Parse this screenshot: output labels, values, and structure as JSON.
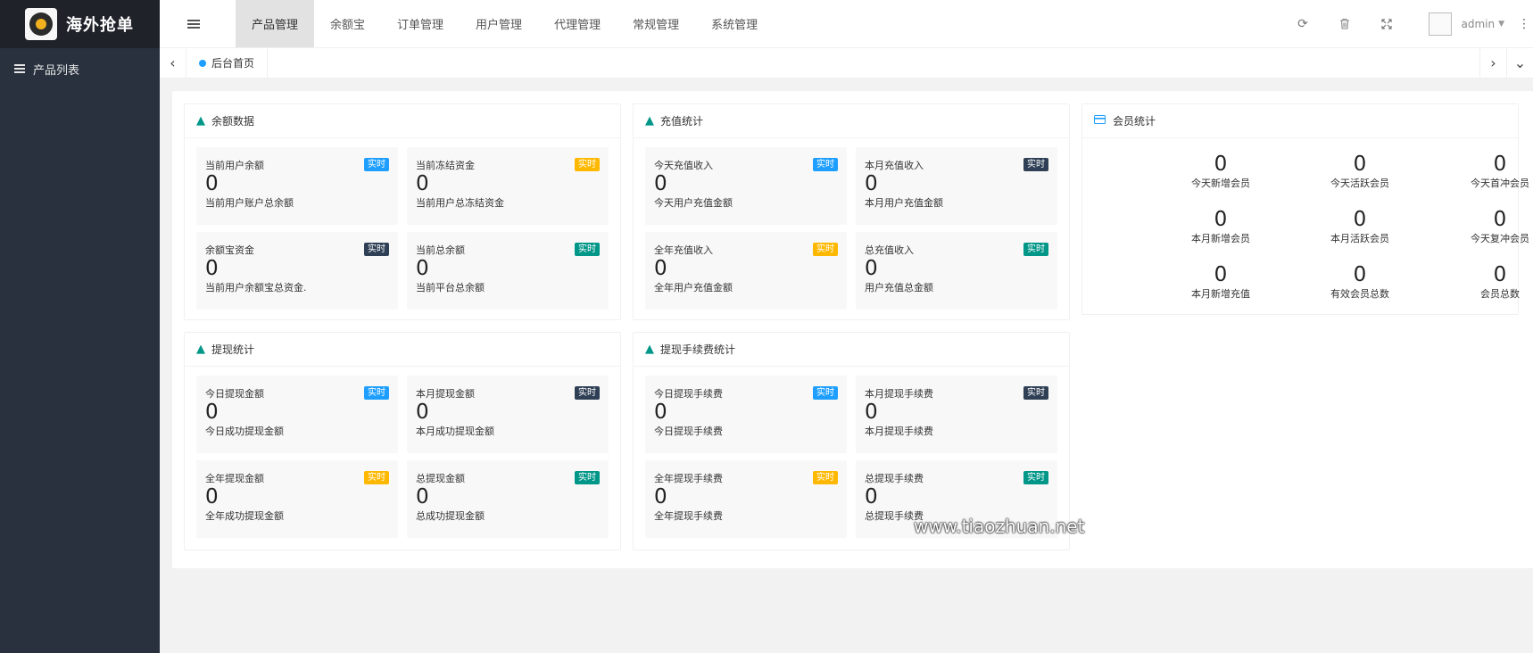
{
  "app": {
    "title": "海外抢单"
  },
  "sidebar": {
    "items": [
      {
        "label": "产品列表"
      }
    ]
  },
  "header": {
    "nav": [
      {
        "label": "产品管理",
        "active": true
      },
      {
        "label": "余额宝"
      },
      {
        "label": "订单管理"
      },
      {
        "label": "用户管理"
      },
      {
        "label": "代理管理"
      },
      {
        "label": "常规管理"
      },
      {
        "label": "系统管理"
      }
    ],
    "user": "admin"
  },
  "tabs": [
    {
      "label": "后台首页"
    }
  ],
  "colors": {
    "blue": "#1e9fff",
    "dark": "#2f4056",
    "orange": "#ffb800",
    "green": "#009688"
  },
  "cards": {
    "balance": {
      "title": "余额数据",
      "boxes": [
        {
          "title": "当前用户余额",
          "badge": "实时",
          "value": "0",
          "desc": "当前用户账户总余额"
        },
        {
          "title": "当前冻结资金",
          "badge": "实时",
          "value": "0",
          "desc": "当前用户总冻结资金"
        },
        {
          "title": "余额宝资金",
          "badge": "实时",
          "value": "0",
          "desc": "当前用户余额宝总资金."
        },
        {
          "title": "当前总余额",
          "badge": "实时",
          "value": "0",
          "desc": "当前平台总余额"
        }
      ]
    },
    "recharge": {
      "title": "充值统计",
      "boxes": [
        {
          "title": "今天充值收入",
          "badge": "实时",
          "value": "0",
          "desc": "今天用户充值金额"
        },
        {
          "title": "本月充值收入",
          "badge": "实时",
          "value": "0",
          "desc": "本月用户充值金额"
        },
        {
          "title": "全年充值收入",
          "badge": "实时",
          "value": "0",
          "desc": "全年用户充值金额"
        },
        {
          "title": "总充值收入",
          "badge": "实时",
          "value": "0",
          "desc": "用户充值总金额"
        }
      ]
    },
    "withdraw": {
      "title": "提现统计",
      "boxes": [
        {
          "title": "今日提现金额",
          "badge": "实时",
          "value": "0",
          "desc": "今日成功提现金额"
        },
        {
          "title": "本月提现金额",
          "badge": "实时",
          "value": "0",
          "desc": "本月成功提现金额"
        },
        {
          "title": "全年提现金额",
          "badge": "实时",
          "value": "0",
          "desc": "全年成功提现金额"
        },
        {
          "title": "总提现金额",
          "badge": "实时",
          "value": "0",
          "desc": "总成功提现金额"
        }
      ]
    },
    "fee": {
      "title": "提现手续费统计",
      "boxes": [
        {
          "title": "今日提现手续费",
          "badge": "实时",
          "value": "0",
          "desc": "今日提现手续费"
        },
        {
          "title": "本月提现手续费",
          "badge": "实时",
          "value": "0",
          "desc": "本月提现手续费"
        },
        {
          "title": "全年提现手续费",
          "badge": "实时",
          "value": "0",
          "desc": "全年提现手续费"
        },
        {
          "title": "总提现手续费",
          "badge": "实时",
          "value": "0",
          "desc": "总提现手续费"
        }
      ]
    },
    "members": {
      "title": "会员统计",
      "stats": [
        {
          "value": "0",
          "label": "今天新增会员"
        },
        {
          "value": "0",
          "label": "今天活跃会员"
        },
        {
          "value": "0",
          "label": "今天首冲会员"
        },
        {
          "value": "0",
          "label": "本月新增会员"
        },
        {
          "value": "0",
          "label": "本月活跃会员"
        },
        {
          "value": "0",
          "label": "今天复冲会员"
        },
        {
          "value": "0",
          "label": "本月新增充值"
        },
        {
          "value": "0",
          "label": "有效会员总数"
        },
        {
          "value": "0",
          "label": "会员总数"
        }
      ]
    }
  },
  "watermark": "www.tiaozhuan.net"
}
